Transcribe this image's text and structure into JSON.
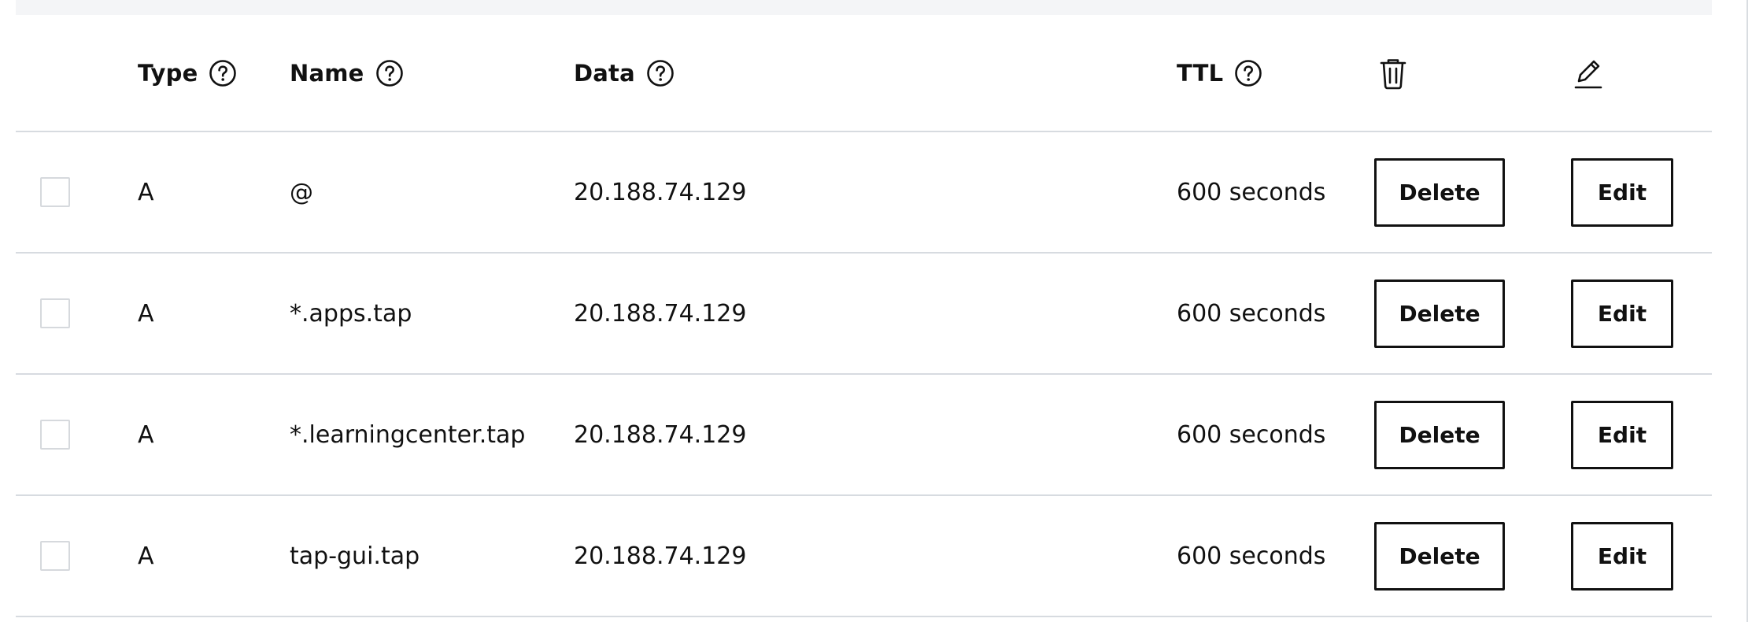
{
  "table": {
    "headers": {
      "type": "Type",
      "name": "Name",
      "data": "Data",
      "ttl": "TTL"
    },
    "header_icons": {
      "help": "help-circle-icon",
      "delete": "trash-icon",
      "edit": "pencil-icon"
    },
    "rows": [
      {
        "type": "A",
        "name": "@",
        "data": "20.188.74.129",
        "ttl": "600 seconds",
        "delete_label": "Delete",
        "edit_label": "Edit",
        "checked": false
      },
      {
        "type": "A",
        "name": "*.apps.tap",
        "data": "20.188.74.129",
        "ttl": "600 seconds",
        "delete_label": "Delete",
        "edit_label": "Edit",
        "checked": false
      },
      {
        "type": "A",
        "name": "*.learningcenter.tap",
        "data": "20.188.74.129",
        "ttl": "600 seconds",
        "delete_label": "Delete",
        "edit_label": "Edit",
        "checked": false
      },
      {
        "type": "A",
        "name": "tap-gui.tap",
        "data": "20.188.74.129",
        "ttl": "600 seconds",
        "delete_label": "Delete",
        "edit_label": "Edit",
        "checked": false
      }
    ]
  },
  "colors": {
    "text": "#111111",
    "border": "#d7dbe0",
    "top_band": "#f4f5f7"
  }
}
